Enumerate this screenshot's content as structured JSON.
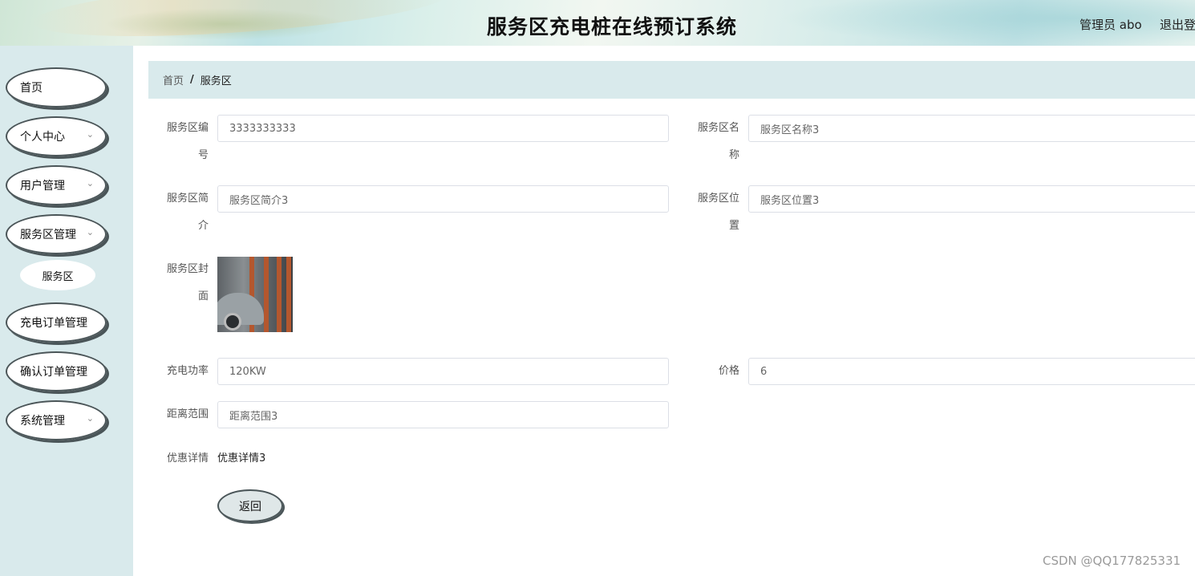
{
  "header": {
    "title": "服务区充电桩在线预订系统",
    "user": "管理员 abo",
    "logout": "退出登"
  },
  "sidebar": {
    "items": [
      {
        "label": "首页",
        "has_arrow": false
      },
      {
        "label": "个人中心",
        "has_arrow": true
      },
      {
        "label": "用户管理",
        "has_arrow": true
      },
      {
        "label": "服务区管理",
        "has_arrow": true
      },
      {
        "label": "服务区",
        "sub": true
      },
      {
        "label": "充电订单管理",
        "has_arrow": false
      },
      {
        "label": "确认订单管理",
        "has_arrow": false
      },
      {
        "label": "系统管理",
        "has_arrow": true
      }
    ],
    "arrow_icon": "chevron-down-icon"
  },
  "breadcrumb": {
    "home": "首页",
    "separator": "/",
    "current": "服务区"
  },
  "form": {
    "code_label_1": "服务区编",
    "code_label_2": "号",
    "code_value": "3333333333",
    "name_label_1": "服务区名",
    "name_label_2": "称",
    "name_value": "服务区名称3",
    "intro_label_1": "服务区简",
    "intro_label_2": "介",
    "intro_value": "服务区简介3",
    "location_label_1": "服务区位",
    "location_label_2": "置",
    "location_value": "服务区位置3",
    "cover_label_1": "服务区封",
    "cover_label_2": "面",
    "power_label": "充电功率",
    "power_value": "120KW",
    "price_label": "价格",
    "price_value": "6",
    "range_label": "距离范围",
    "range_value": "距离范围3",
    "discount_label": "优惠详情",
    "discount_value": "优惠详情3",
    "back_button": "返回"
  },
  "watermark": "CSDN @QQ177825331",
  "colors": {
    "sidebar_bg": "#d9eaec",
    "breadcrumb_bg": "#d9eaec",
    "menu_border": "#4a5558"
  }
}
